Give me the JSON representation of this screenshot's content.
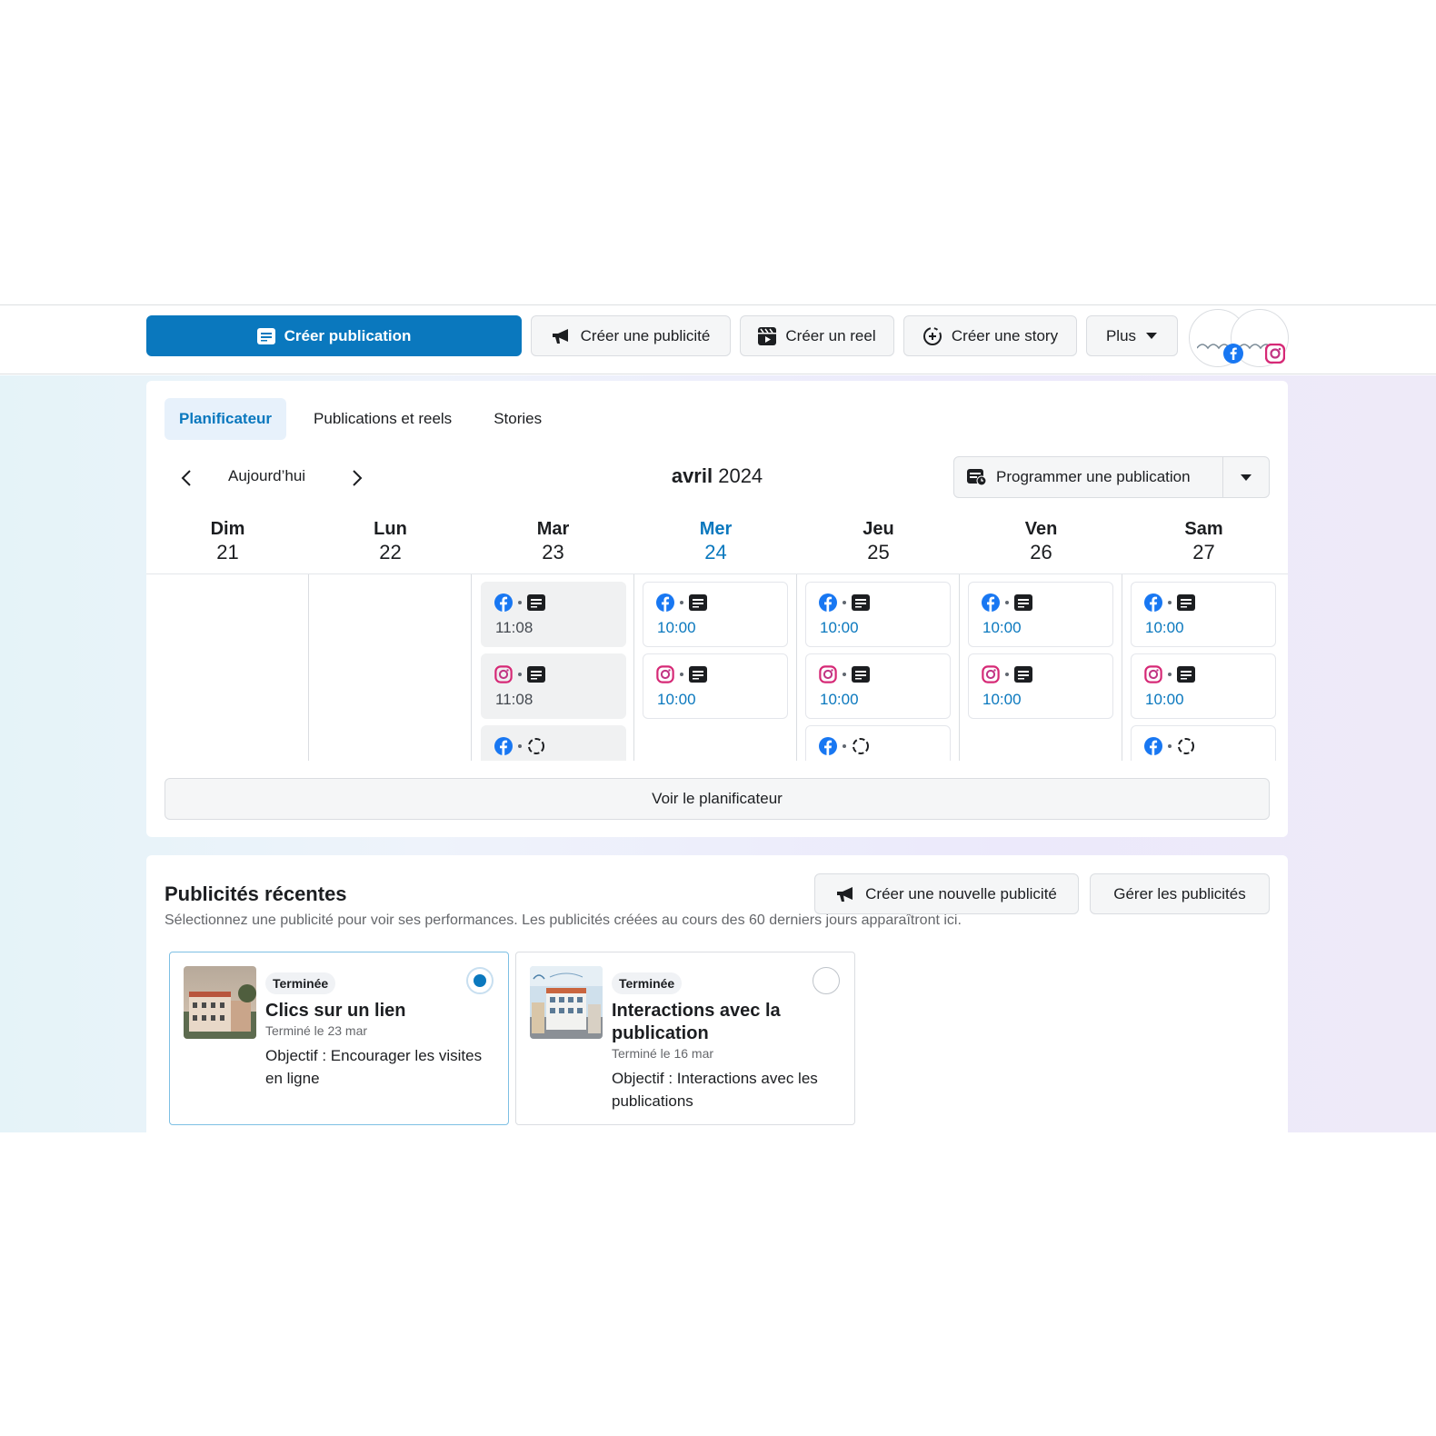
{
  "toolbar": {
    "create_post": "Créer publication",
    "create_ad": "Créer une publicité",
    "create_reel": "Créer un reel",
    "create_story": "Créer une story",
    "more": "Plus"
  },
  "planner": {
    "tabs": [
      "Planificateur",
      "Publications et reels",
      "Stories"
    ],
    "today_label": "Aujourd’hui",
    "month": "avril",
    "year": "2024",
    "schedule_button": "Programmer une publication",
    "see_planner": "Voir le planificateur",
    "days": [
      {
        "name": "Dim",
        "num": "21"
      },
      {
        "name": "Lun",
        "num": "22"
      },
      {
        "name": "Mar",
        "num": "23"
      },
      {
        "name": "Mer",
        "num": "24"
      },
      {
        "name": "Jeu",
        "num": "25"
      },
      {
        "name": "Ven",
        "num": "26"
      },
      {
        "name": "Sam",
        "num": "27"
      }
    ],
    "posts": {
      "mar_fb": "11:08",
      "mar_ig": "11:08",
      "mer_fb": "10:00",
      "mer_ig": "10:00",
      "jeu_fb": "10:00",
      "jeu_ig": "10:00",
      "ven_fb": "10:00",
      "ven_ig": "10:00",
      "sam_fb": "10:00",
      "sam_ig": "10:00"
    }
  },
  "ads": {
    "title": "Publicités récentes",
    "subtitle": "Sélectionnez une publicité pour voir ses performances. Les publicités créées au cours des 60 derniers jours apparaîtront ici.",
    "new_ad": "Créer une nouvelle publicité",
    "manage": "Gérer les publicités",
    "items": [
      {
        "status": "Terminée",
        "title": "Clics sur un lien",
        "date": "Terminé le 23 mar",
        "objective": "Objectif : Encourager les visites en ligne",
        "selected": true
      },
      {
        "status": "Terminée",
        "title": "Interactions avec la publication",
        "date": "Terminé le 16 mar",
        "objective": "Objectif : Interactions avec les publications",
        "selected": false
      }
    ]
  },
  "colors": {
    "accent": "#0a78be",
    "facebook": "#1877f2",
    "instagram": "#c13584"
  }
}
